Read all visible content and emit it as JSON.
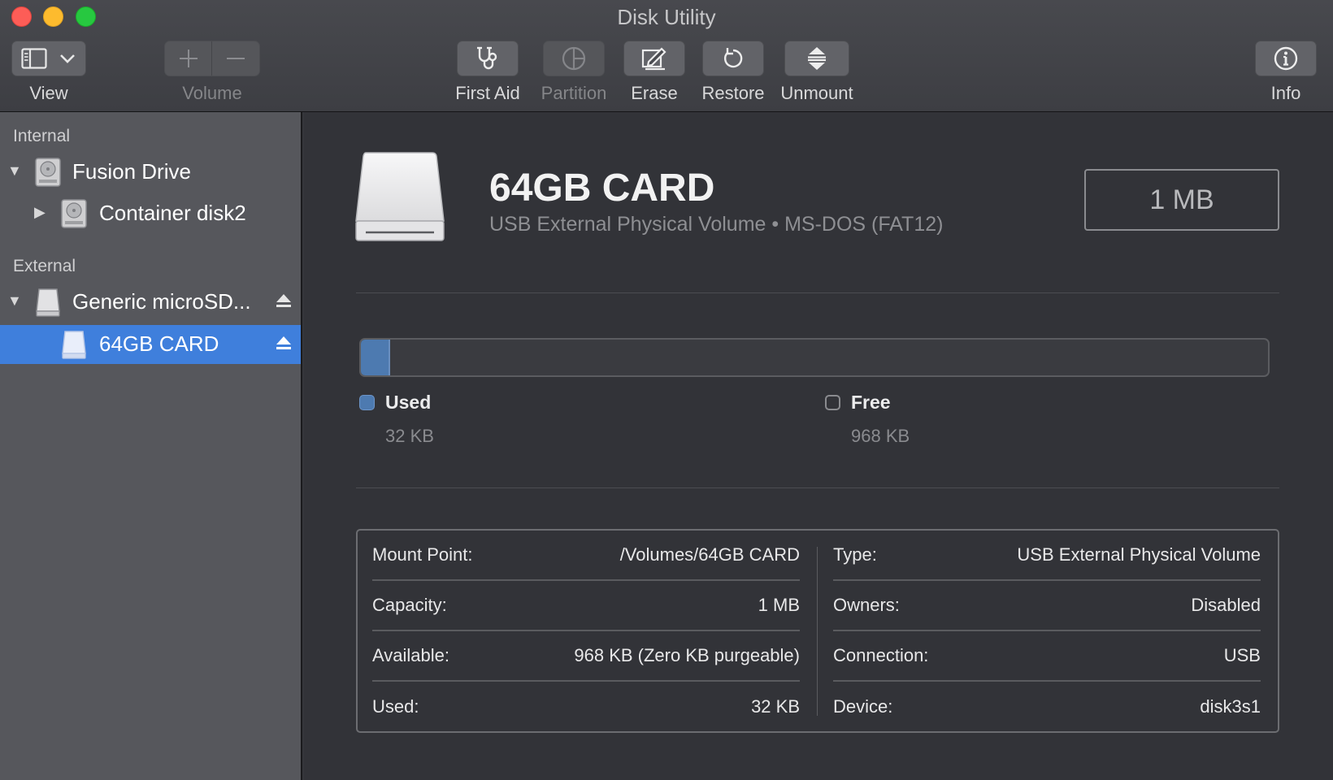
{
  "window": {
    "title": "Disk Utility"
  },
  "toolbar": {
    "view_label": "View",
    "volume_label": "Volume",
    "first_aid_label": "First Aid",
    "partition_label": "Partition",
    "erase_label": "Erase",
    "restore_label": "Restore",
    "unmount_label": "Unmount",
    "info_label": "Info"
  },
  "sidebar": {
    "internal_header": "Internal",
    "external_header": "External",
    "items": [
      {
        "label": "Fusion Drive"
      },
      {
        "label": "Container disk2"
      },
      {
        "label": "Generic microSD..."
      },
      {
        "label": "64GB CARD"
      }
    ]
  },
  "volume": {
    "name": "64GB CARD",
    "subtitle": "USB External Physical Volume • MS-DOS (FAT12)",
    "size": "1 MB"
  },
  "usage": {
    "used_fraction": 0.032,
    "used_label": "Used",
    "used_value": "32 KB",
    "free_label": "Free",
    "free_value": "968 KB",
    "used_color": "#4d7ab0"
  },
  "info": {
    "left": [
      {
        "key": "Mount Point:",
        "value": "/Volumes/64GB CARD"
      },
      {
        "key": "Capacity:",
        "value": "1 MB"
      },
      {
        "key": "Available:",
        "value": "968 KB (Zero KB purgeable)"
      },
      {
        "key": "Used:",
        "value": "32 KB"
      }
    ],
    "right": [
      {
        "key": "Type:",
        "value": "USB External Physical Volume"
      },
      {
        "key": "Owners:",
        "value": "Disabled"
      },
      {
        "key": "Connection:",
        "value": "USB"
      },
      {
        "key": "Device:",
        "value": "disk3s1"
      }
    ]
  }
}
